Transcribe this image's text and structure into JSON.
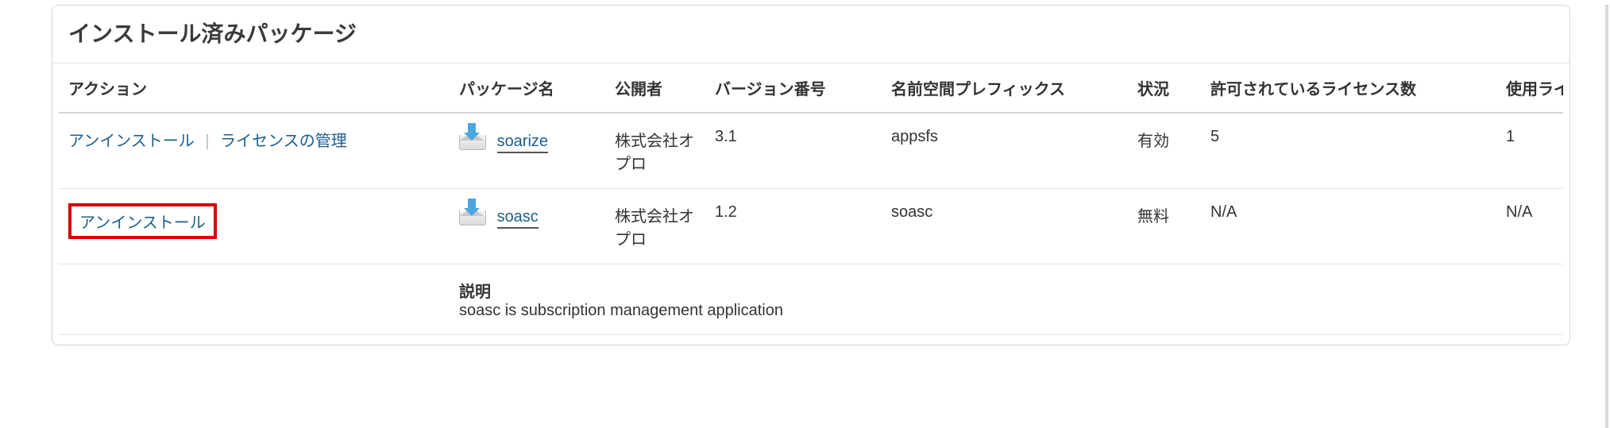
{
  "panel": {
    "title": "インストール済みパッケージ"
  },
  "columns": {
    "action": "アクション",
    "package_name": "パッケージ名",
    "publisher": "公開者",
    "version": "バージョン番号",
    "namespace": "名前空間プレフィックス",
    "status": "状況",
    "licenses": "許可されているライセンス数",
    "used": "使用ライセ"
  },
  "labels": {
    "uninstall": "アンインストール",
    "manage_licenses": "ライセンスの管理",
    "description_header": "説明"
  },
  "rows": [
    {
      "actions": {
        "has_manage": true,
        "highlight": false
      },
      "package_name": "soarize",
      "publisher": "株式会社オプロ",
      "version": "3.1",
      "namespace": "appsfs",
      "status": "有効",
      "licenses": "5",
      "used": "1"
    },
    {
      "actions": {
        "has_manage": false,
        "highlight": true
      },
      "package_name": "soasc",
      "publisher": "株式会社オプロ",
      "version": "1.2",
      "namespace": "soasc",
      "status": "無料",
      "licenses": "N/A",
      "used": "N/A",
      "description": "soasc is subscription management application"
    }
  ]
}
